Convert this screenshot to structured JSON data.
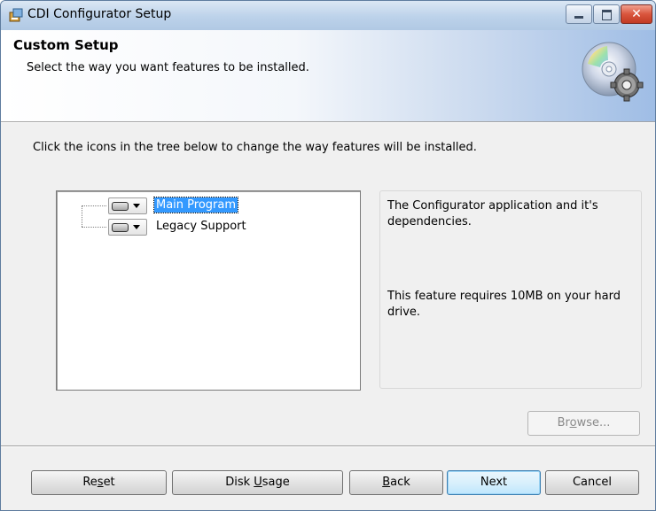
{
  "window": {
    "title": "CDI Configurator Setup",
    "controls": {
      "minimize": "minimize",
      "maximize": "maximize",
      "close": "close"
    }
  },
  "header": {
    "title": "Custom Setup",
    "subtitle": "Select the way you want features to be installed.",
    "image_icon": "cd-disc-gear-icon"
  },
  "instructions": "Click the icons in the tree below to change the way features will be installed.",
  "features": [
    {
      "label": "Main Program",
      "selected": true,
      "icon": "hard-drive-icon"
    },
    {
      "label": "Legacy Support",
      "selected": false,
      "icon": "hard-drive-icon"
    }
  ],
  "description": {
    "text": "The Configurator application and it's dependencies.",
    "requirement": "This feature requires 10MB on your hard drive."
  },
  "buttons": {
    "browse": {
      "label_pre": "Br",
      "label_accel": "o",
      "label_post": "wse...",
      "enabled": false
    },
    "reset": {
      "label_pre": "Re",
      "label_accel": "s",
      "label_post": "et"
    },
    "disk_usage": {
      "label_pre": "Disk ",
      "label_accel": "U",
      "label_post": "sage"
    },
    "back": {
      "label_pre": "",
      "label_accel": "B",
      "label_post": "ack"
    },
    "next": {
      "label": "Next"
    },
    "cancel": {
      "label": "Cancel"
    }
  },
  "colors": {
    "selection": "#3399ff",
    "title_bar": "#bcd2ea",
    "close_button": "#c23a22"
  }
}
